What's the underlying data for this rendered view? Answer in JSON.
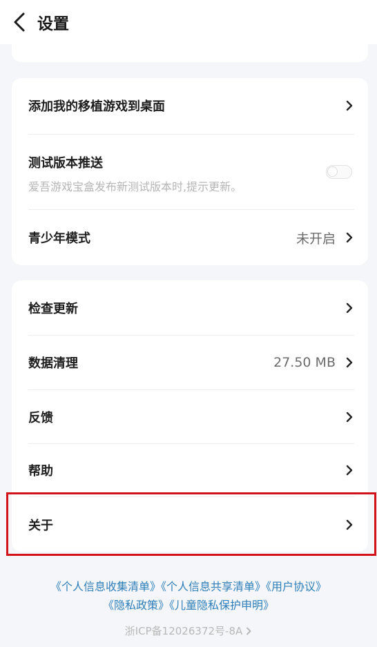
{
  "header": {
    "title": "设置"
  },
  "card1": {
    "add_to_desktop": "添加我的移植游戏到桌面",
    "test_push_title": "测试版本推送",
    "test_push_desc": "爱吾游戏宝盒发布新测试版本时,提示更新。",
    "test_push_enabled": false,
    "teen_mode_label": "青少年模式",
    "teen_mode_value": "未开启"
  },
  "card2": {
    "check_update": "检查更新",
    "data_clean_label": "数据清理",
    "data_clean_value": "27.50 MB",
    "feedback": "反馈",
    "help": "帮助",
    "about": "关于"
  },
  "links": {
    "personal_info_list": "《个人信息收集清单》",
    "personal_info_share": "《个人信息共享清单》",
    "user_agreement": "《用户协议》",
    "privacy_policy": "《隐私政策》",
    "child_privacy": "《儿童隐私保护申明》"
  },
  "footer": {
    "icp": "浙ICP备12026372号-8A"
  },
  "colors": {
    "link": "#2f7fb7",
    "highlight": "#d3111a",
    "background": "#f4f6fa"
  },
  "icons": {
    "back": "back-arrow-icon",
    "chevron": "chevron-right-icon"
  }
}
